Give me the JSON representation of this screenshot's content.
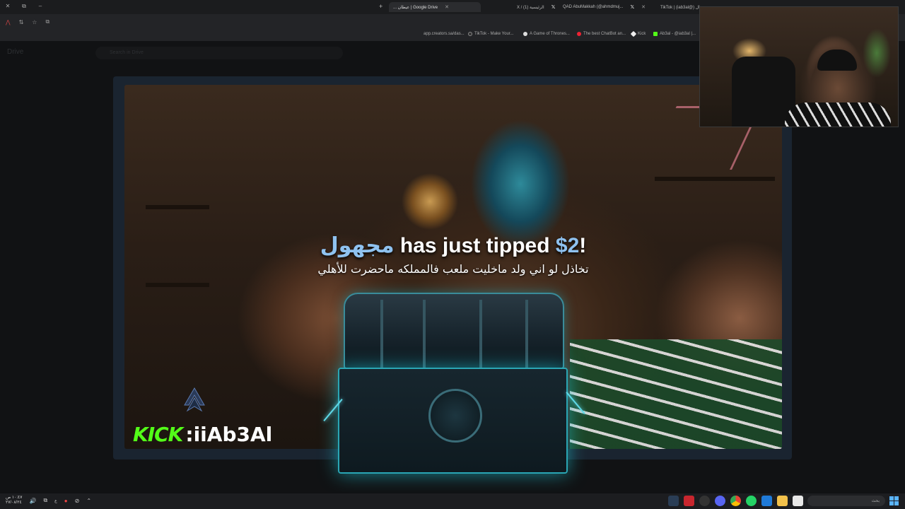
{
  "browser": {
    "tabs": [
      {
        "label": "... عيطان | Google Drive",
        "active": true
      },
      {
        "label": "X / (1) الرئيسية"
      },
      {
        "label": "QAD AbuMakkah (@ahmdmuj..."
      },
      {
        "label": "TikTok | (iab3al@) ال..."
      }
    ],
    "bookmarks": [
      {
        "label": "app.creators.sa/das..."
      },
      {
        "label": "TikTok - Make Your..."
      },
      {
        "label": "A Game of Thrones..."
      },
      {
        "label": "The best ChatBot an..."
      },
      {
        "label": "Kick"
      },
      {
        "label": "Ab3al - @iab3al |..."
      }
    ]
  },
  "drive": {
    "logo": "Drive",
    "search_placeholder": "Search in Drive"
  },
  "alert": {
    "username": "مجهول",
    "action": " has just tipped ",
    "amount": "$2",
    "suffix": "!",
    "message": "تخاذل لو اني ولد ماخليت ملعب فالمملكه ماحضرت للأهلي"
  },
  "branding": {
    "kick_word": "KICK",
    "handle": ":iiAb3Al",
    "kick_color": "#53fc18"
  },
  "taskbar": {
    "clock_time": "١٠:٤٧ ص",
    "clock_date": "٢٧/٠٨/٢٤",
    "language": "ع",
    "search_placeholder": "بحث"
  },
  "icons": [
    "close-icon",
    "restore-icon",
    "minimize-icon",
    "new-tab-icon",
    "x-logo-icon",
    "star-icon",
    "windows-start-icon"
  ]
}
